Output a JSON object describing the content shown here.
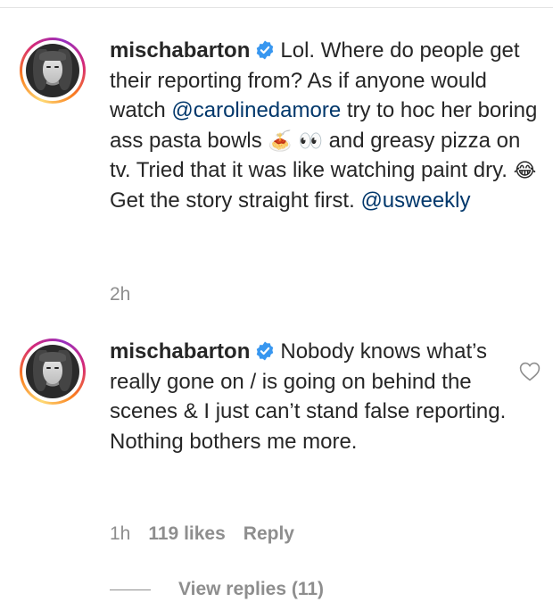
{
  "comments": [
    {
      "username": "mischabarton",
      "text": {
        "p1": "Lol. Where do people get their reporting from? As if anyone would watch ",
        "mention1": "@carolinedamore",
        "p2": " try to hoc her boring ass pasta bowls ",
        "emoji_pasta": "🍝",
        "emoji_eyes": "👀",
        "p3": " and greasy pizza on tv. Tried that it was like watching paint dry. ",
        "emoji_laugh": "😂",
        "p4": "  Get the story straight first. ",
        "mention2": "@usweekly"
      },
      "time": "2h"
    },
    {
      "username": "mischabarton",
      "text": "Nobody knows what’s really gone on / is going on behind the scenes & I just can’t stand false reporting. Nothing bothers me more.",
      "time": "1h",
      "likes": "119 likes",
      "reply_label": "Reply"
    }
  ],
  "view_replies": "View replies (11)",
  "icons": {
    "verified": "verified-badge-icon",
    "like": "heart-outline-icon"
  },
  "colors": {
    "verified_blue": "#3897f0",
    "mention": "#00376b",
    "meta_gray": "#8e8e8e",
    "text": "#262626"
  }
}
